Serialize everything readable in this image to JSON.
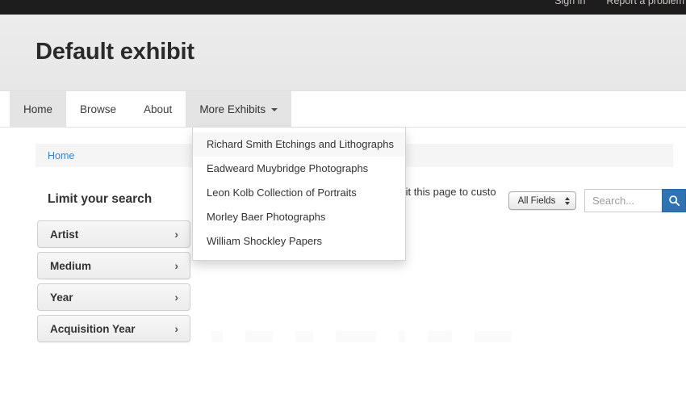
{
  "topbar": {
    "links": [
      {
        "label": "Sign in",
        "name": "sign-in-link"
      },
      {
        "label": "Report a problem",
        "name": "report-problem-link"
      }
    ]
  },
  "masthead": {
    "site_title": "Default exhibit"
  },
  "nav": {
    "tabs": [
      {
        "label": "Home",
        "state": "active"
      },
      {
        "label": "Browse",
        "state": "default"
      },
      {
        "label": "About",
        "state": "default"
      },
      {
        "label": "More Exhibits",
        "state": "open",
        "has_caret": true
      }
    ]
  },
  "dropdown": {
    "open": true,
    "items": [
      {
        "label": "Richard Smith Etchings and Lithographs",
        "hover": true
      },
      {
        "label": "Eadweard Muybridge Photographs",
        "hover": false
      },
      {
        "label": "Leon Kolb Collection of Portraits",
        "hover": false
      },
      {
        "label": "Morley Baer Photographs",
        "hover": false
      },
      {
        "label": "William Shockley Papers",
        "hover": false
      }
    ]
  },
  "search": {
    "field_selector_value": "All Fields",
    "placeholder": "Search...",
    "input_value": "",
    "button_icon": "search-icon",
    "button_color": "#2f73b3"
  },
  "breadcrumb": {
    "items": [
      {
        "label": "Home",
        "link_color": "#3b7fc4"
      }
    ]
  },
  "sidebar": {
    "heading": "Limit your search",
    "facets": [
      {
        "label": "Artist",
        "chevron": "›"
      },
      {
        "label": "Medium",
        "chevron": "›"
      },
      {
        "label": "Year",
        "chevron": "›"
      },
      {
        "label": "Acquisition Year",
        "chevron": "›"
      }
    ]
  },
  "main": {
    "paragraph": "homepage. Curators of this exhibit can edit this page to custo"
  }
}
